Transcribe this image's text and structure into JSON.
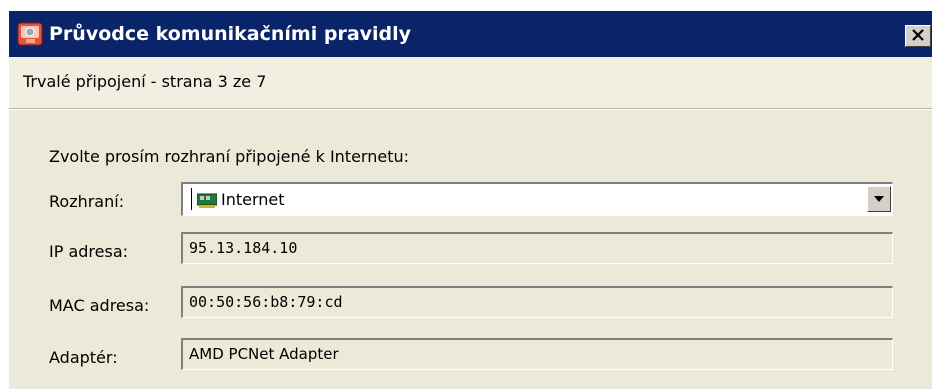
{
  "window": {
    "title": "Průvodce komunikačními pravidly",
    "app_icon": "wizard-app-icon",
    "close_icon": "close-x-icon"
  },
  "header": {
    "subtitle": "Trvalé připojení - strana 3 ze 7"
  },
  "form": {
    "prompt": "Zvolte prosím rozhraní připojené k Internetu:",
    "interface": {
      "label": "Rozhraní:",
      "value": "Internet",
      "icon": "network-card-icon",
      "dropdown_icon": "dropdown-arrow-icon"
    },
    "ip": {
      "label": "IP adresa:",
      "value": "95.13.184.10"
    },
    "mac": {
      "label": "MAC adresa:",
      "value": "00:50:56:b8:79:cd"
    },
    "adapter": {
      "label": "Adaptér:",
      "value": "AMD PCNet Adapter"
    }
  },
  "colors": {
    "titlebar": "#0a246a",
    "dialog_face": "#ece9d8",
    "header_band": "#f1efe2"
  }
}
